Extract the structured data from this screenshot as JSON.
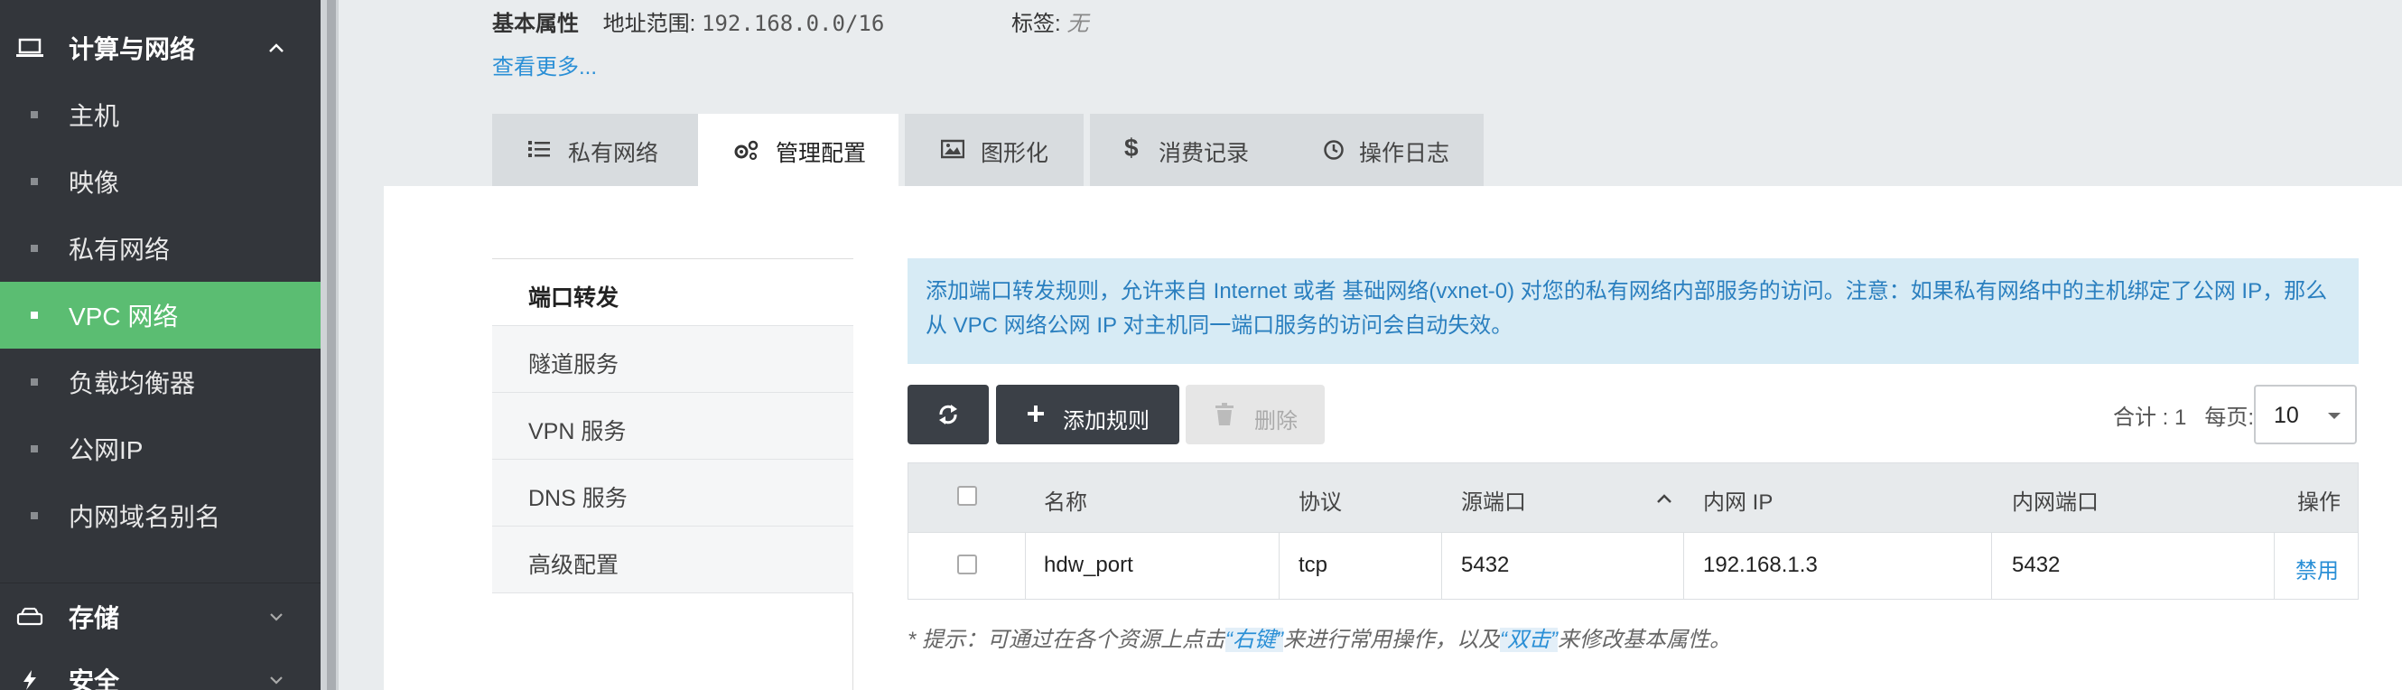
{
  "sidebar": {
    "group_compute": "计算与网络",
    "items": [
      {
        "label": "主机"
      },
      {
        "label": "映像"
      },
      {
        "label": "私有网络"
      },
      {
        "label": "VPC 网络"
      },
      {
        "label": "负载均衡器"
      },
      {
        "label": "公网IP"
      },
      {
        "label": "内网域名别名"
      }
    ],
    "active_item": "VPC 网络",
    "group_storage": "存储",
    "group_security": "安全"
  },
  "info": {
    "basic_label": "基本属性",
    "range_label": "地址范围:",
    "range_value": "192.168.0.0/16",
    "tag_label": "标签:",
    "tag_value": "无",
    "see_more": "查看更多..."
  },
  "tabs": [
    {
      "label": "私有网络",
      "icon": "list-icon"
    },
    {
      "label": "管理配置",
      "icon": "gears-icon",
      "active": true
    },
    {
      "label": "图形化",
      "icon": "image-icon"
    },
    {
      "label": "消费记录",
      "icon": "dollar-icon"
    },
    {
      "label": "操作日志",
      "icon": "clock-icon"
    }
  ],
  "subnav": [
    {
      "label": "端口转发",
      "active": true
    },
    {
      "label": "隧道服务"
    },
    {
      "label": "VPN 服务"
    },
    {
      "label": "DNS 服务"
    },
    {
      "label": "高级配置"
    }
  ],
  "notice": {
    "line1": "添加端口转发规则，允许来自 Internet 或者 基础网络(vxnet-0) 对您的私有网络内部服务的访问。注意：如果私有网络中的主机绑定了公网 IP，那么",
    "line2": "从 VPC 网络公网 IP 对主机同一端口服务的访问会自动失效。"
  },
  "toolbar": {
    "add_label": "添加规则",
    "delete_label": "删除",
    "total_text": "合计 : 1",
    "per_page_label": "每页:",
    "per_page_value": "10"
  },
  "table": {
    "headers": [
      "名称",
      "协议",
      "源端口",
      "内网 IP",
      "内网端口",
      "操作"
    ],
    "rows": [
      {
        "name": "hdw_port",
        "protocol": "tcp",
        "src_port": "5432",
        "internal_ip": "192.168.1.3",
        "internal_port": "5432",
        "action": "禁用"
      }
    ]
  },
  "hint": {
    "prefix": "* 提示：可通过在各个资源上点击",
    "right_click": "“右键”",
    "middle": "来进行常用操作，以及",
    "double_click": "“双击”",
    "suffix": "来修改基本属性。"
  },
  "colors": {
    "sidebar_bg": "#33363b",
    "sidebar_active": "#5bbd72",
    "link": "#2a8fd6",
    "notice_bg": "#d7ebf5",
    "dark_button": "#3b4047"
  }
}
